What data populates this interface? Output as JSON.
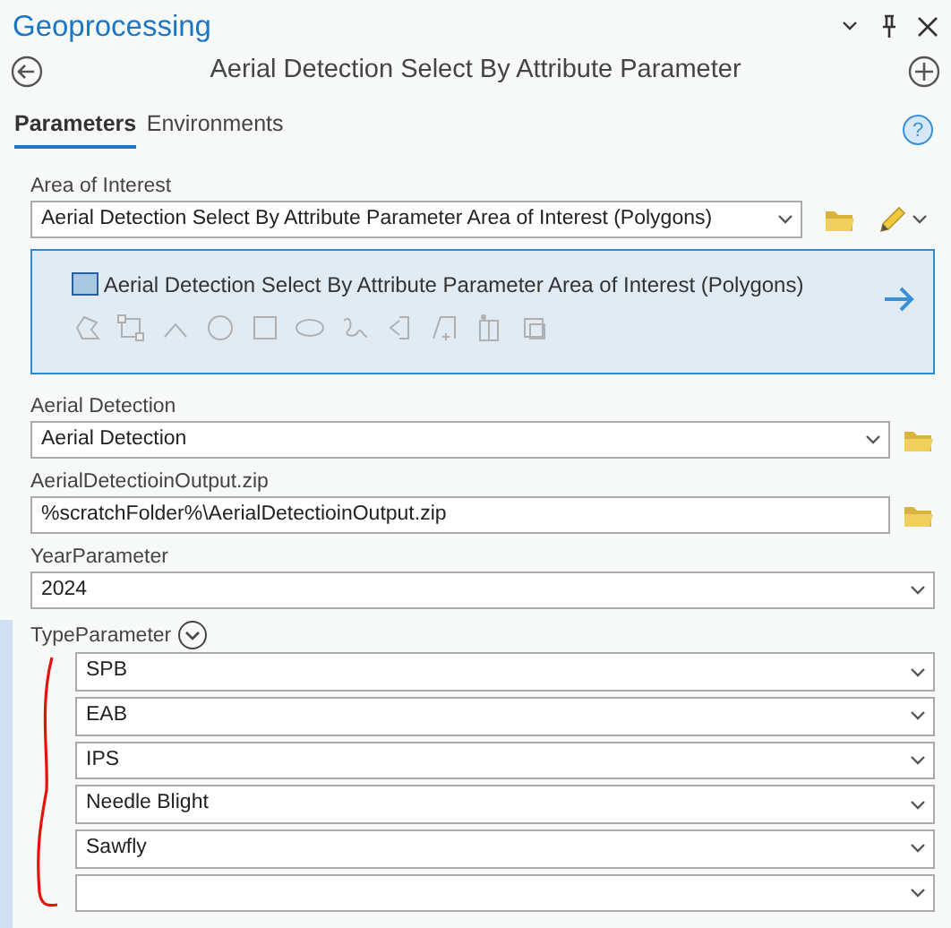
{
  "panel": {
    "title": "Geoprocessing"
  },
  "tool": {
    "title": "Aerial Detection Select By Attribute Parameter"
  },
  "tabs": [
    {
      "label": "Parameters",
      "selected": true
    },
    {
      "label": "Environments",
      "selected": false
    }
  ],
  "help": {
    "label": "?"
  },
  "parameters": [
    {
      "kind": "feature_set",
      "label": "Area of Interest",
      "value": "Aerial Detection Select By Attribute Parameter Area of Interest (Polygons)",
      "sketch_layer": "Aerial Detection Select By Attribute Parameter Area of Interest (Polygons)"
    },
    {
      "kind": "dropdown",
      "label": "Aerial Detection",
      "value": "Aerial Detection",
      "browse": true
    },
    {
      "kind": "text",
      "label": "AerialDetectioinOutput.zip",
      "value": "%scratchFolder%\\AerialDetectioinOutput.zip",
      "browse": true
    },
    {
      "kind": "dropdown",
      "label": "YearParameter",
      "value": "2024",
      "browse": false
    },
    {
      "kind": "multivalue",
      "label": "TypeParameter",
      "expanded": true,
      "values": [
        "SPB",
        "EAB",
        "IPS",
        "Needle Blight",
        "Sawfly"
      ]
    }
  ]
}
